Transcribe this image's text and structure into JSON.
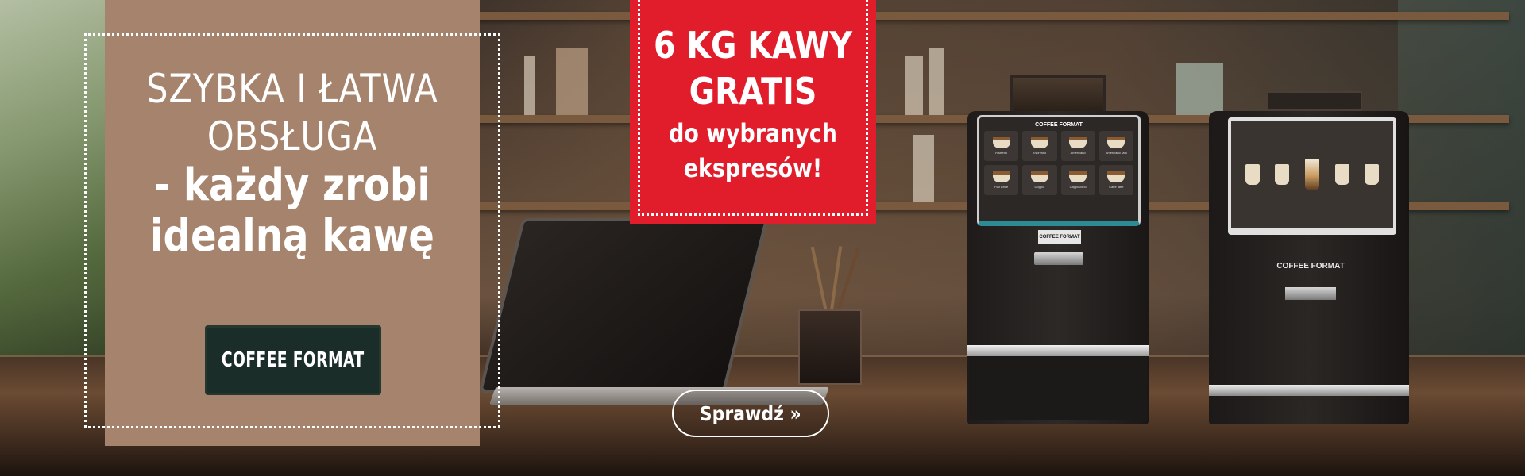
{
  "panel": {
    "line1": "SZYBKA I ŁATWA",
    "line2": "OBSŁUGA",
    "line3": "- każdy zrobi",
    "line4": "idealną kawę",
    "logo": "COFFEE FORMAT"
  },
  "promo_badge": {
    "line1": "6 KG KAWY",
    "line2": "GRATIS",
    "line3": "do wybranych",
    "line4": "ekspresów!",
    "background_color": "#e11d2c"
  },
  "cta": {
    "label": "Sprawdź »"
  },
  "machine1": {
    "screen_title": "COFFEE FORMAT",
    "plate_label": "COFFEE FORMAT",
    "drinks": [
      "Ristretto",
      "Espresso",
      "Americano",
      "Americano Milk",
      "Flat white",
      "Doppio",
      "Cappuccino",
      "Caffè latte"
    ]
  },
  "machine2": {
    "brand_label": "COFFEE FORMAT"
  },
  "colors": {
    "panel_bg": "#a6836c",
    "logo_bg": "#1a2d28",
    "text": "#ffffff"
  }
}
